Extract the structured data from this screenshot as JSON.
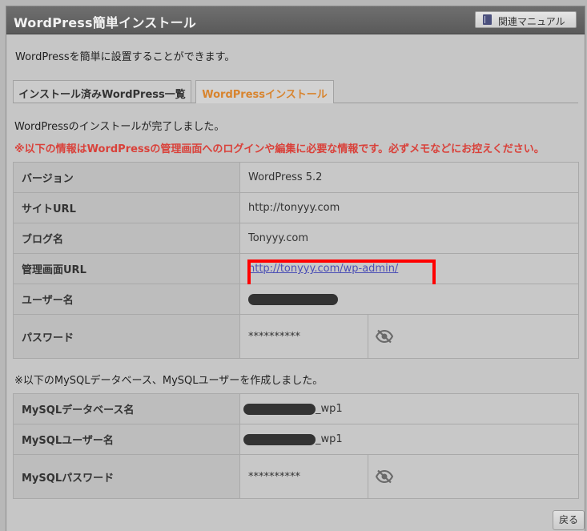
{
  "header": {
    "title": "WordPress簡単インストール",
    "manual_label": "関連マニュアル"
  },
  "description": "WordPressを簡単に設置することができます。",
  "tabs": [
    {
      "label": "インストール済みWordPress一覧",
      "active": false
    },
    {
      "label": "WordPressインストール",
      "active": true
    }
  ],
  "done_message": "WordPressのインストールが完了しました。",
  "warning": "※以下の情報はWordPressの管理画面へのログインや編集に必要な情報です。必ずメモなどにお控えください。",
  "info_rows": [
    {
      "label": "バージョン",
      "value": "WordPress 5.2"
    },
    {
      "label": "サイトURL",
      "value": "http://tonyyy.com"
    },
    {
      "label": "ブログ名",
      "value": "Tonyyy.com"
    },
    {
      "label": "管理画面URL",
      "value": "http://tonyyy.com/wp-admin/"
    },
    {
      "label": "ユーザー名",
      "value": ""
    },
    {
      "label": "パスワード",
      "value": "**********"
    }
  ],
  "mysql_note": "※以下のMySQLデータベース、MySQLユーザーを作成しました。",
  "mysql_rows": [
    {
      "label": "MySQLデータベース名",
      "suffix": "_wp1"
    },
    {
      "label": "MySQLユーザー名",
      "suffix": "_wp1"
    },
    {
      "label": "MySQLパスワード",
      "value": "**********"
    }
  ],
  "back_label": "戻る",
  "icons": {
    "manual": "book-icon",
    "eye": "eye-slash-icon"
  },
  "colors": {
    "warning": "#d9413a",
    "active_tab": "#d8842e",
    "link": "#4b4fb5",
    "highlight": "#ff0000"
  }
}
